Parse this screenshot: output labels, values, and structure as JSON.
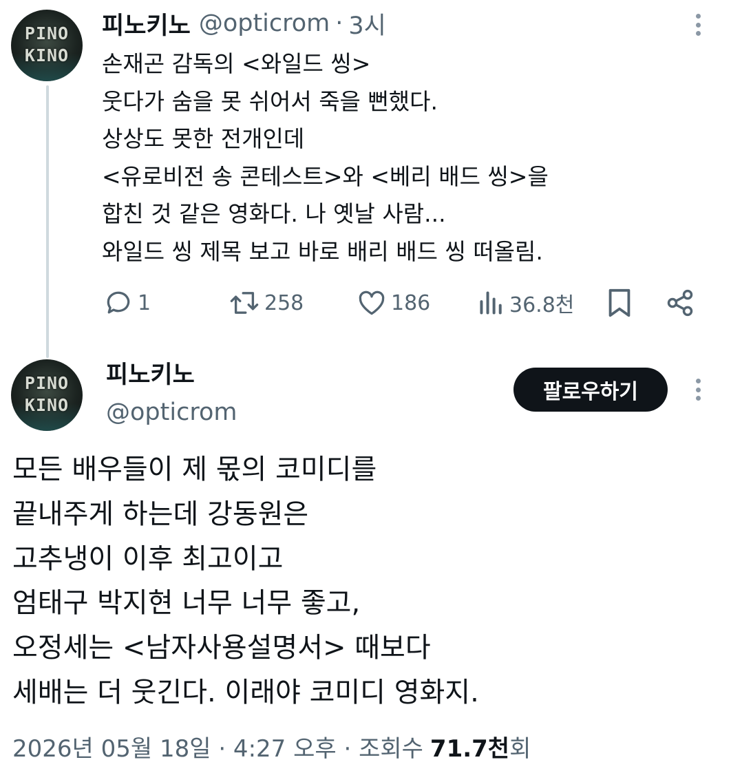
{
  "tweet1": {
    "author_name": "피노키노",
    "handle": "@opticrom",
    "separator": "·",
    "time": "3시",
    "avatar_text": [
      "PINO",
      "KINO"
    ],
    "lines": [
      "손재곤 감독의 <와일드 씽>",
      "웃다가 숨을 못 쉬어서 죽을 뻔했다.",
      "상상도 못한 전개인데",
      "<유로비전 송 콘테스트>와 <베리 배드 씽>을",
      "합친 것 같은 영화다. 나 옛날 사람...",
      "와일드 씽 제목 보고 바로 배리 배드 씽 떠올림."
    ],
    "actions": {
      "replies": "1",
      "retweets": "258",
      "likes": "186",
      "views": "36.8천"
    }
  },
  "tweet2": {
    "author_name": "피노키노",
    "handle": "@opticrom",
    "avatar_text": [
      "PINO",
      "KINO"
    ],
    "follow_label": "팔로우하기",
    "lines": [
      "모든 배우들이 제 몫의 코미디를",
      "끝내주게 하는데 강동원은",
      "고추냉이 이후 최고이고",
      "엄태구 박지현 너무 너무 좋고,",
      "오정세는 <남자사용설명서> 때보다",
      "세배는 더 웃긴다. 이래야 코미디 영화지."
    ],
    "meta": {
      "date_time": "2026년 05월 18일 · 4:27 오후 · 조회수",
      "view_count": "71.7천",
      "view_suffix": "회"
    }
  },
  "colors": {
    "text": "#0f1419",
    "muted": "#536471",
    "thread_line": "#cfd9de",
    "follow_button_bg": "#0f1419"
  },
  "icons": {
    "reply": "reply-icon",
    "retweet": "retweet-icon",
    "like": "heart-icon",
    "views": "views-chart-icon",
    "bookmark": "bookmark-icon",
    "share": "share-icon",
    "more": "more-dots-icon"
  }
}
